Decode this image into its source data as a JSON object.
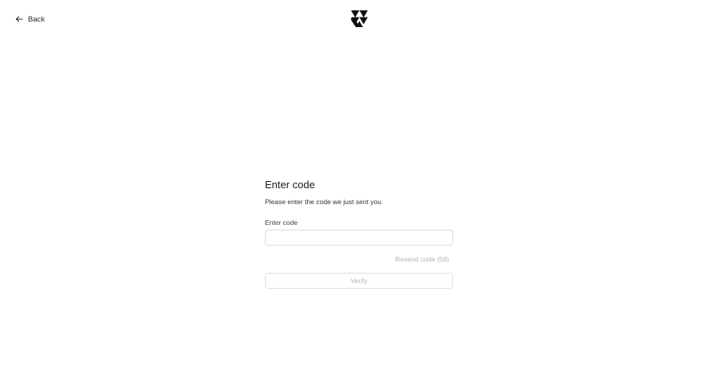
{
  "header": {
    "back_label": "Back",
    "back_icon": "arrow-left-icon",
    "logo_icon": "brand-logo-icon"
  },
  "form": {
    "title": "Enter code",
    "subtitle": "Please enter the code we just sent you",
    "code_label": "Enter code",
    "code_value": "",
    "code_placeholder": "",
    "resend_label": "Resend code (59)",
    "verify_label": "Verify"
  },
  "colors": {
    "text": "#1a1a1a",
    "muted": "#b3b3b3",
    "border": "#dcdcdc",
    "background": "#ffffff"
  }
}
